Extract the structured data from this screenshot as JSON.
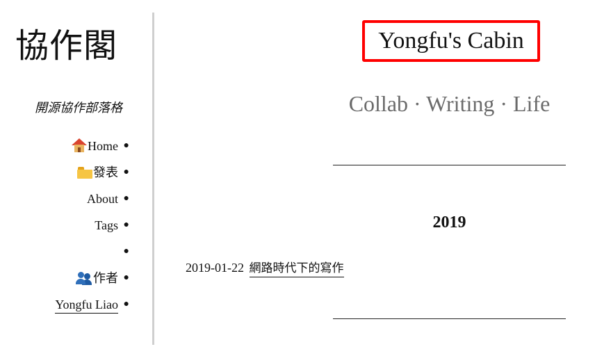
{
  "sidebar": {
    "logo": "協作閣",
    "tagline": "開源協作部落格",
    "nav": [
      {
        "label": "Home",
        "icon": "house-icon"
      },
      {
        "label": "發表",
        "icon": "folder-icon"
      },
      {
        "label": "About",
        "icon": ""
      },
      {
        "label": "Tags",
        "icon": ""
      },
      {
        "label": "",
        "icon": ""
      },
      {
        "label": "作者",
        "icon": "people-icon"
      },
      {
        "label": "Yongfu Liao",
        "icon": ""
      }
    ],
    "bullet": "●"
  },
  "header": {
    "title": "Yongfu's Cabin",
    "subtitle": "Collab · Writing · Life",
    "highlight_color": "#ff0000"
  },
  "archive": {
    "year": "2019",
    "posts": [
      {
        "date": "2019-01-22",
        "title": "網路時代下的寫作"
      }
    ]
  },
  "colors": {
    "text": "#111111",
    "subtitle": "#6b6b6b",
    "sidebar_rule": "#cfcfcf"
  }
}
